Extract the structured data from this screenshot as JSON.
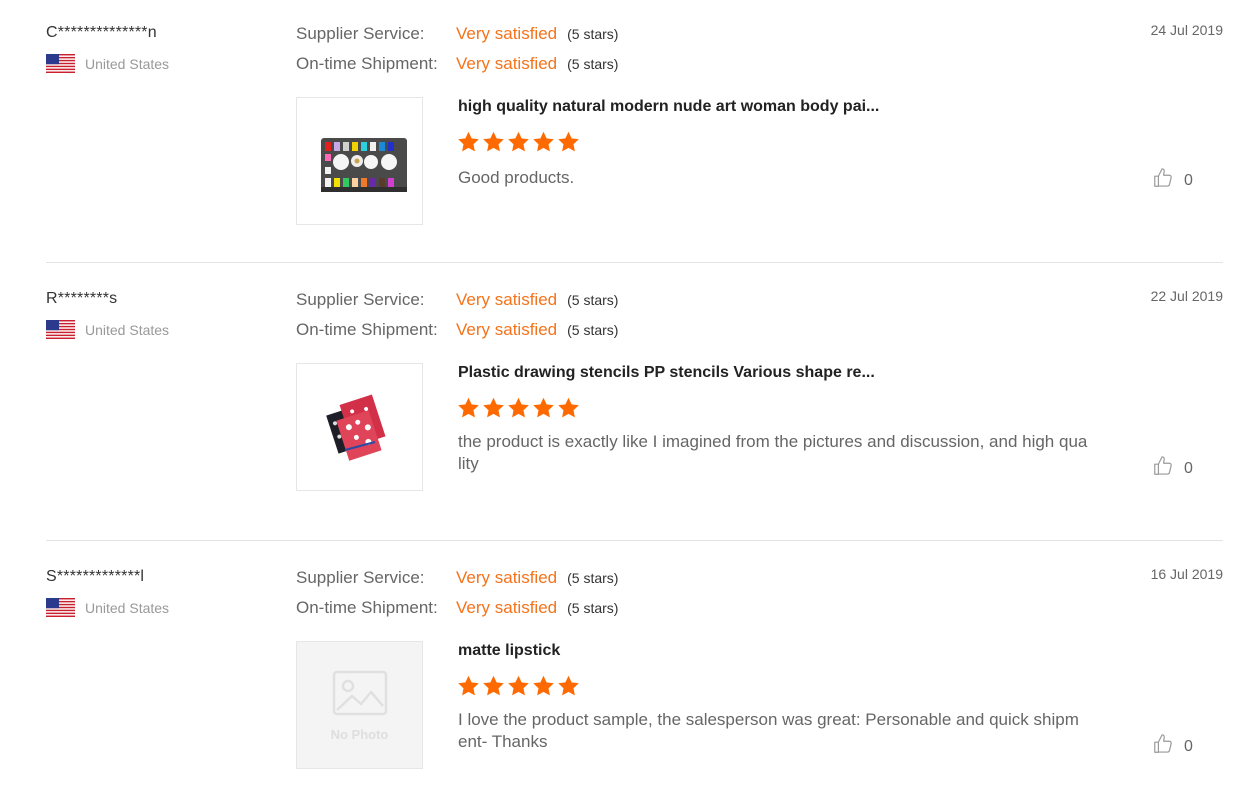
{
  "reviews": [
    {
      "buyer_name": "C**************n",
      "country": "United States",
      "supplier_service_label": "Supplier Service:",
      "supplier_service_value": "Very satisfied",
      "supplier_service_count": "(5 stars)",
      "shipment_label": "On-time Shipment:",
      "shipment_value": "Very satisfied",
      "shipment_count": "(5 stars)",
      "date": "24 Jul 2019",
      "product_title": "high quality natural modern nude art woman body pai...",
      "stars": 5,
      "text": "Good products.",
      "likes": "0",
      "image": "palette"
    },
    {
      "buyer_name": "R********s",
      "country": "United States",
      "supplier_service_label": "Supplier Service:",
      "supplier_service_value": "Very satisfied",
      "supplier_service_count": "(5 stars)",
      "shipment_label": "On-time Shipment:",
      "shipment_value": "Very satisfied",
      "shipment_count": "(5 stars)",
      "date": "22 Jul 2019",
      "product_title": "Plastic drawing stencils PP stencils Various shape re...",
      "stars": 5,
      "text": "the product is exactly like I imagined from the pictures and discussion, and high quality",
      "likes": "0",
      "image": "stencils"
    },
    {
      "buyer_name": "S*************l",
      "country": "United States",
      "supplier_service_label": "Supplier Service:",
      "supplier_service_value": "Very satisfied",
      "supplier_service_count": "(5 stars)",
      "shipment_label": "On-time Shipment:",
      "shipment_value": "Very satisfied",
      "shipment_count": "(5 stars)",
      "date": "16 Jul 2019",
      "product_title": "matte lipstick",
      "stars": 5,
      "text": "I love the product sample, the salesperson was great:  Personable and quick shipment- Thanks",
      "likes": "0",
      "image": "no-photo",
      "no_photo_text": "No Photo"
    }
  ],
  "colors": {
    "accent": "#f5731b",
    "star": "#ff6a00",
    "divider": "#e3e3e3"
  },
  "icons": [
    "us-flag-icon",
    "star-icon",
    "thumbs-up-icon",
    "no-photo-icon"
  ]
}
